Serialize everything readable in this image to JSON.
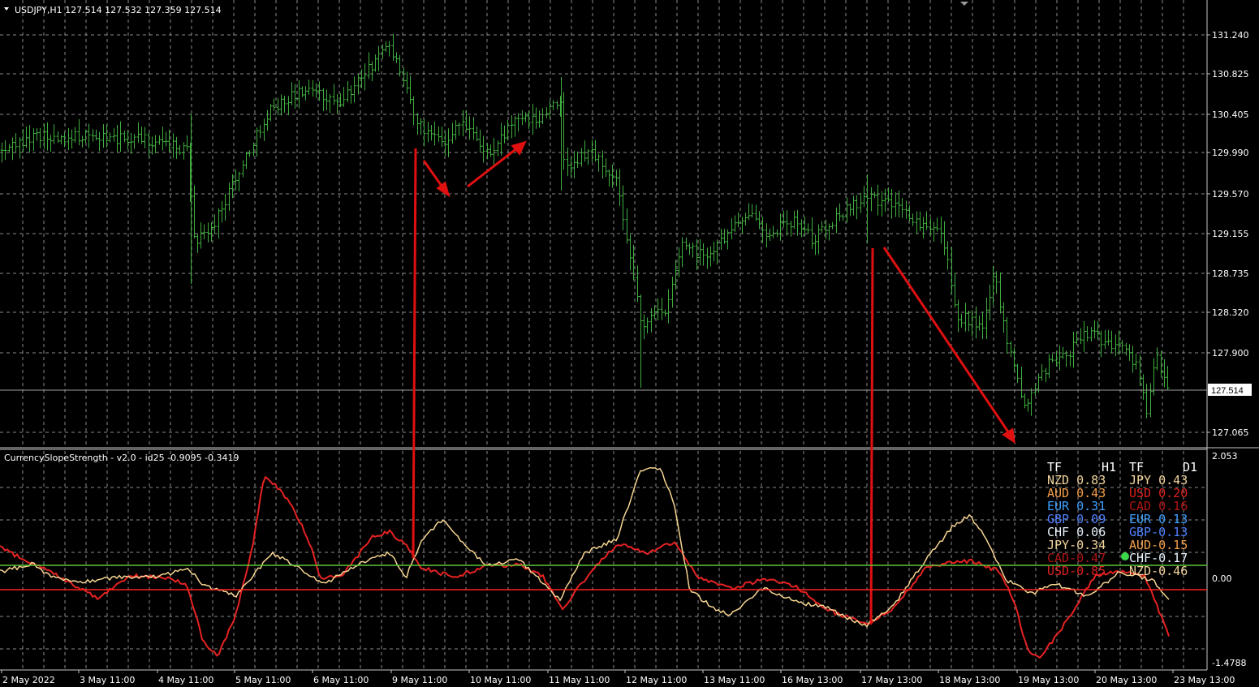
{
  "window": {
    "symbol_header": "USDJPY,H1  127.514 127.532 127.359 127.514",
    "current_price_tag": "127.514"
  },
  "indicator": {
    "header": "CurrencySlopeStrength - v2.0 - id25 -0.9095 -0.3419",
    "upper_level_color": "#5cc839",
    "lower_level_color": "#ff2020"
  },
  "strength_table": {
    "h1_header": [
      "TF",
      "H1"
    ],
    "d1_header": [
      "TF",
      "D1"
    ],
    "h1_rows": [
      {
        "text": "NZD 0.83",
        "color": "#f5d79e"
      },
      {
        "text": "AUD 0.43",
        "color": "#f5a04a"
      },
      {
        "text": "EUR 0.31",
        "color": "#3fa0ff"
      },
      {
        "text": "GBP 0.09",
        "color": "#5080ff"
      },
      {
        "text": "CHF 0.06",
        "color": "#e8f4ff"
      },
      {
        "text": "JPY-0.34",
        "color": "#f5d79e"
      },
      {
        "text": "CAD-0.47",
        "color": "#b01515"
      },
      {
        "text": "USD-0.85",
        "color": "#e02020"
      }
    ],
    "d1_rows": [
      {
        "text": "JPY 0.43",
        "color": "#f5d79e"
      },
      {
        "text": "USD 0.20",
        "color": "#e02020"
      },
      {
        "text": "CAD 0.16",
        "color": "#b01515"
      },
      {
        "text": "EUR 0.13",
        "color": "#3fa0ff"
      },
      {
        "text": "GBP-0.13",
        "color": "#5080ff"
      },
      {
        "text": "AUD-0.15",
        "color": "#f5a04a"
      },
      {
        "text": "CHF-0.17",
        "color": "#e8f4ff"
      },
      {
        "text": "NZD-0.46",
        "color": "#f5d79e"
      }
    ]
  },
  "price_axis": [
    "131.240",
    "130.825",
    "130.405",
    "129.990",
    "129.570",
    "129.155",
    "128.735",
    "128.320",
    "127.900",
    "127.065"
  ],
  "indicator_axis": [
    "2.053",
    "0.00",
    "-1.4788"
  ],
  "time_axis": [
    "2 May 2022",
    "3 May 11:00",
    "4 May 11:00",
    "5 May 11:00",
    "6 May 11:00",
    "9 May 11:00",
    "10 May 11:00",
    "11 May 11:00",
    "12 May 11:00",
    "13 May 11:00",
    "16 May 13:00",
    "17 May 13:00",
    "18 May 13:00",
    "19 May 13:00",
    "20 May 13:00",
    "23 May 13:00"
  ],
  "colors": {
    "background": "#000000",
    "grid": "#8a8a8a",
    "candles": "#3fae3f",
    "jpy_line": "#f7d592",
    "usd_line": "#e62222",
    "annotation_arrows": "#e01010"
  },
  "chart_data": [
    {
      "type": "line",
      "name": "USDJPY,H1 price",
      "x": [
        "2 May 2022",
        "3 May 11:00",
        "4 May 11:00",
        "5 May 11:00",
        "6 May 11:00",
        "9 May 11:00",
        "10 May 11:00",
        "11 May 11:00",
        "12 May 11:00",
        "13 May 11:00",
        "16 May 13:00",
        "17 May 13:00",
        "18 May 13:00",
        "19 May 13:00",
        "20 May 13:00",
        "23 May 13:00"
      ],
      "values": [
        130.1,
        130.1,
        129.4,
        130.4,
        130.9,
        131.15,
        130.35,
        130.45,
        128.0,
        129.35,
        129.5,
        129.6,
        129.2,
        127.8,
        128.05,
        127.51
      ],
      "ylim": [
        126.83,
        131.5
      ]
    },
    {
      "type": "line",
      "name": "CurrencySlopeStrength",
      "x": [
        "2 May 2022",
        "3 May 11:00",
        "4 May 11:00",
        "5 May 11:00",
        "6 May 11:00",
        "9 May 11:00",
        "10 May 11:00",
        "11 May 11:00",
        "12 May 11:00",
        "13 May 11:00",
        "16 May 13:00",
        "17 May 13:00",
        "18 May 13:00",
        "19 May 13:00",
        "20 May 13:00",
        "23 May 13:00"
      ],
      "series": [
        {
          "name": "JPY",
          "values": [
            0.1,
            -0.1,
            -0.05,
            0.4,
            0.3,
            0.3,
            0.2,
            -0.1,
            1.9,
            -0.3,
            0.0,
            -0.8,
            0.9,
            -0.1,
            -0.1,
            -0.3
          ]
        },
        {
          "name": "USD",
          "values": [
            0.5,
            -0.2,
            -1.1,
            1.6,
            0.1,
            0.5,
            0.1,
            -0.3,
            0.5,
            -0.1,
            -0.2,
            -0.8,
            0.2,
            -1.4,
            0.0,
            -0.9
          ]
        }
      ],
      "ylim": [
        -1.4788,
        2.053
      ]
    }
  ]
}
